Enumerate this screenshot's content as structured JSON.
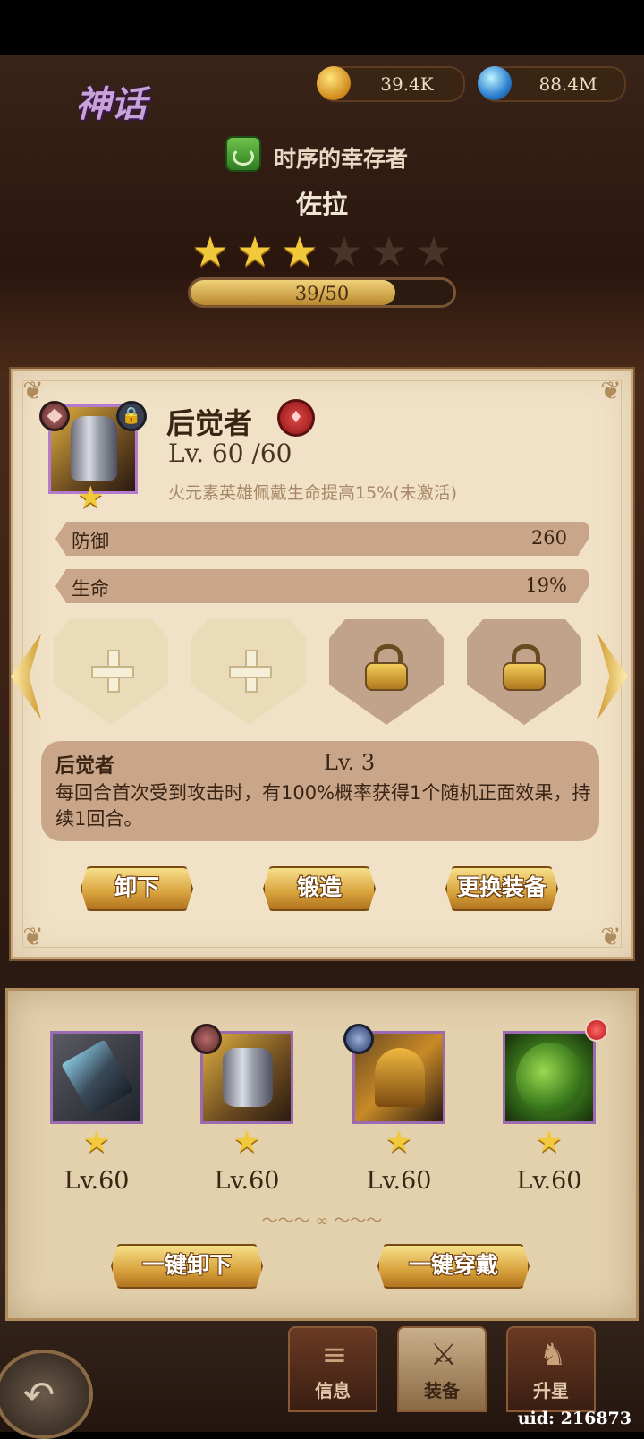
{
  "header": {
    "rarity": "神话",
    "gold": "39.4K",
    "gems": "88.4M"
  },
  "hero": {
    "title": "时序的幸存者",
    "name": "佐拉",
    "stars_filled": 3,
    "stars_total": 6,
    "progress_text": "39/50",
    "progress_value": 39,
    "progress_max": 50
  },
  "equipment": {
    "name": "后觉者",
    "level": "Lv. 60 /60",
    "effect": "火元素英雄佩戴生命提高15%(未激活)",
    "stats": [
      {
        "label": "防御",
        "value": "260"
      },
      {
        "label": "生命",
        "value": "19%"
      }
    ],
    "slots": [
      "empty",
      "empty",
      "locked",
      "locked"
    ],
    "skill": {
      "name": "后觉者",
      "level": "Lv. 3",
      "description": "每回合首次受到攻击时，有100%概率获得1个随机正面效果，持续1回合。"
    },
    "buttons": {
      "unequip": "卸下",
      "forge": "锻造",
      "replace": "更换装备"
    }
  },
  "inventory": {
    "items": [
      {
        "icon": "hammer-weapon-icon",
        "level": "Lv.60"
      },
      {
        "icon": "armor-icon",
        "level": "Lv.60"
      },
      {
        "icon": "helmet-icon",
        "level": "Lv.60"
      },
      {
        "icon": "turtle-shell-icon",
        "level": "Lv.60"
      }
    ],
    "unequip_all": "一键卸下",
    "equip_all": "一键穿戴"
  },
  "tabs": {
    "info": "信息",
    "equip": "装备",
    "star_up": "升星"
  },
  "footer": {
    "uid": "uid: 216873"
  },
  "colors": {
    "accent_gold": "#f2c93a",
    "panel_bg": "#f1e2c7",
    "rarity_purple": "#c9a2d8"
  }
}
